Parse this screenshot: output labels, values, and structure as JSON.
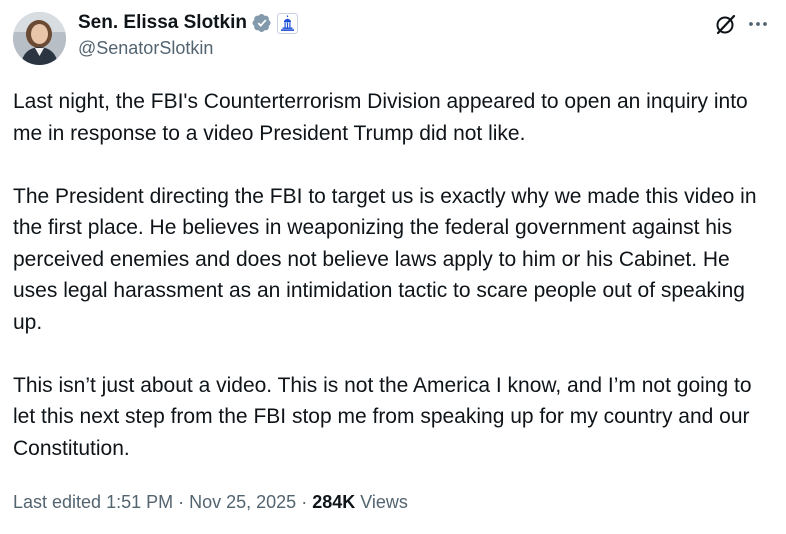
{
  "author": {
    "display_name": "Sen. Elissa Slotkin",
    "handle": "@SenatorSlotkin",
    "verified_color": "#829aab",
    "gov_badge_color": "#1d4ed8"
  },
  "tweet": {
    "paragraphs": [
      "Last night, the FBI's Counterterrorism Division appeared to open an inquiry into me in response to a video President Trump did not like.",
      "The President directing the FBI to target us is exactly why we made this video in the first place. He believes in weaponizing the federal government against his perceived enemies and does not believe laws apply to him or his Cabinet. He uses legal harassment as an intimidation tactic to scare people out of speaking up.",
      "This isn’t just about a video. This is not the America I know, and I’m not going to let this next step from the FBI stop me from speaking up for my country and our Constitution."
    ]
  },
  "meta": {
    "edited_label": "Last edited 1:51 PM",
    "separator": "·",
    "date": "Nov 25, 2025",
    "views_count": "284K",
    "views_label": "Views"
  },
  "icons": {
    "verified": "verified-badge-icon",
    "government": "government-badge-icon",
    "grok": "grok-icon",
    "more": "more-options-icon"
  },
  "colors": {
    "text_primary": "#0f1419",
    "text_secondary": "#536471"
  }
}
